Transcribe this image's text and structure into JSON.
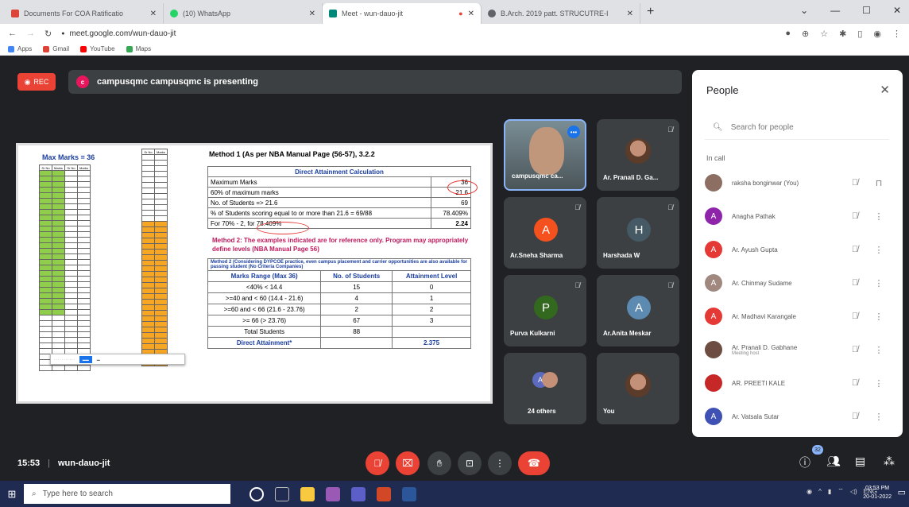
{
  "browser": {
    "tabs": [
      {
        "label": "Documents For COA Ratificatio",
        "color": "#db4437",
        "active": false
      },
      {
        "label": "(10) WhatsApp",
        "color": "#25d366",
        "active": false
      },
      {
        "label": "Meet - wun-dauo-jit",
        "color": "#00897b",
        "active": true
      },
      {
        "label": "B.Arch. 2019 patt. STRUCUTRE-I",
        "color": "#5f6368",
        "active": false
      }
    ],
    "new_tab": "+",
    "url": "meet.google.com/wun-dauo-jit",
    "bookmarks": [
      "Apps",
      "Gmail",
      "YouTube",
      "Maps"
    ]
  },
  "meet": {
    "rec_label": "REC",
    "presenter_initial": "c",
    "presenter_banner": "campusqmc campusqmc is presenting",
    "meeting_time": "15:53",
    "meeting_code": "wun-dauo-jit",
    "participant_count": "32"
  },
  "slide": {
    "max_marks": "Max Marks = 36",
    "method1_title": "Method 1 (As per NBA Manual Page (56-57), 3.2.2",
    "calc_header": "Direct Attainment Calculation",
    "calc_rows": [
      {
        "label": "Maximum Marks",
        "value": "36"
      },
      {
        "label": "60% of maximum marks",
        "value": "21.6"
      },
      {
        "label": "No. of Students => 21.6",
        "value": "69"
      },
      {
        "label": "% of Students scoring equal to or more than 21.6 = 69/88",
        "value": "78.409%"
      },
      {
        "label": "For 70% - 2, for 78.409%",
        "value": "2.24"
      }
    ],
    "method2_note": "Method 2: The examples indicated are for reference only. Program may appropriately define levels (NBA Manual Page 56)",
    "method2_title": "Method 2 (Considering DYPCOE practice, even campus placement and carrier opportunities are also available for passing student (No Criteria Companies)",
    "range_headers": [
      "Marks Range (Max 36)",
      "No. of Students",
      "Attainment Level"
    ],
    "range_rows": [
      [
        "<40% < 14.4",
        "15",
        "0"
      ],
      [
        ">=40 and < 60 (14.4 - 21.6)",
        "4",
        "1"
      ],
      [
        ">=60 and < 66 (21.6 - 23.76)",
        "2",
        "2"
      ],
      [
        ">= 66 (> 23.76)",
        "67",
        "3"
      ]
    ],
    "total_label": "Total Students",
    "total_value": "88",
    "direct_label": "Direct Attainment*",
    "direct_value": "2.375"
  },
  "tiles": [
    {
      "name": "campusqmc ca...",
      "kind": "camera"
    },
    {
      "name": "Ar. Pranali D. Ga...",
      "kind": "photo"
    },
    {
      "name": "Ar.Sneha Sharma",
      "kind": "initial",
      "initial": "A",
      "color": "#f4511e"
    },
    {
      "name": "Harshada W",
      "kind": "initial",
      "initial": "H",
      "color": "#455a64"
    },
    {
      "name": "Purva Kulkarni",
      "kind": "initial",
      "initial": "P",
      "color": "#33691e"
    },
    {
      "name": "Ar.Anita Meskar",
      "kind": "initial",
      "initial": "A",
      "color": "#5c8ab0"
    },
    {
      "name": "24 others",
      "kind": "others"
    },
    {
      "name": "You",
      "kind": "photo"
    }
  ],
  "people_panel": {
    "title": "People",
    "search_placeholder": "Search for people",
    "section": "In call",
    "participants": [
      {
        "name": "raksha bonginwar (You)",
        "initial": "",
        "color": "#8d6e63",
        "sub": ""
      },
      {
        "name": "Anagha Pathak",
        "initial": "A",
        "color": "#8e24aa",
        "sub": ""
      },
      {
        "name": "Ar. Ayush Gupta",
        "initial": "A",
        "color": "#e53935",
        "sub": ""
      },
      {
        "name": "Ar. Chinmay Sudame",
        "initial": "A",
        "color": "#a1887f",
        "sub": ""
      },
      {
        "name": "Ar. Madhavi Karangale",
        "initial": "A",
        "color": "#e53935",
        "sub": ""
      },
      {
        "name": "Ar. Pranali D. Gabhane",
        "initial": "",
        "color": "#6d4c41",
        "sub": "Meeting host"
      },
      {
        "name": "AR. PREETI KALE",
        "initial": "",
        "color": "#c62828",
        "sub": ""
      },
      {
        "name": "Ar. Vatsala Sutar",
        "initial": "A",
        "color": "#3f51b5",
        "sub": ""
      }
    ]
  },
  "taskbar": {
    "search_placeholder": "Type here to search",
    "lang": "ENG",
    "time": "03:53 PM",
    "date": "20-01-2022"
  }
}
